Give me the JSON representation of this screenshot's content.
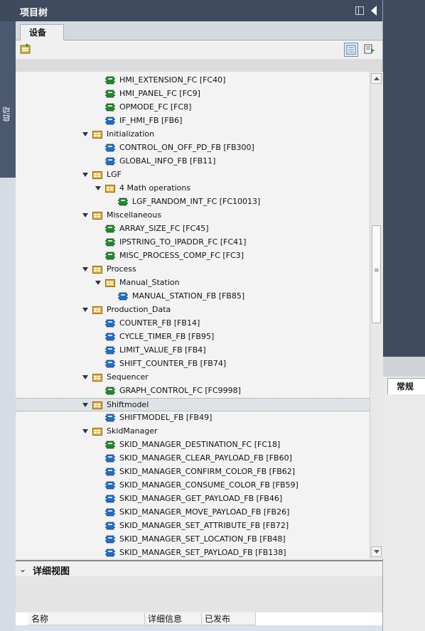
{
  "panel": {
    "title": "项目树",
    "side_tab": "启动",
    "tabs": [
      {
        "label": "设备"
      }
    ]
  },
  "tree": {
    "rows": [
      {
        "label": "HMI_EXTENSION_FC [FC40]",
        "icon": "fc-block-icon",
        "level": 3
      },
      {
        "label": "HMI_PANEL_FC [FC9]",
        "icon": "fc-block-icon",
        "level": 3
      },
      {
        "label": "OPMODE_FC [FC8]",
        "icon": "fc-block-icon",
        "level": 3
      },
      {
        "label": "IF_HMI_FB [FB6]",
        "icon": "fb-block-icon",
        "level": 3
      },
      {
        "label": "Initialization",
        "icon": "folder-icon",
        "level": 2,
        "expanded": true
      },
      {
        "label": "CONTROL_ON_OFF_PD_FB [FB300]",
        "icon": "fb-block-icon",
        "level": 3
      },
      {
        "label": "GLOBAL_INFO_FB [FB11]",
        "icon": "fb-block-icon",
        "level": 3
      },
      {
        "label": "LGF",
        "icon": "folder-icon",
        "level": 2,
        "expanded": true
      },
      {
        "label": "4 Math operations",
        "icon": "folder-icon",
        "level": 3,
        "expanded": true
      },
      {
        "label": "LGF_RANDOM_INT_FC [FC10013]",
        "icon": "fc-block-icon",
        "level": 4
      },
      {
        "label": "Miscellaneous",
        "icon": "folder-icon",
        "level": 2,
        "expanded": true
      },
      {
        "label": "ARRAY_SIZE_FC [FC45]",
        "icon": "fc-block-icon",
        "level": 3
      },
      {
        "label": "IPSTRING_TO_IPADDR_FC [FC41]",
        "icon": "fc-block-icon",
        "level": 3
      },
      {
        "label": "MISC_PROCESS_COMP_FC [FC3]",
        "icon": "fc-block-icon",
        "level": 3
      },
      {
        "label": "Process",
        "icon": "folder-icon",
        "level": 2,
        "expanded": true
      },
      {
        "label": "Manual_Station",
        "icon": "folder-icon",
        "level": 3,
        "expanded": true
      },
      {
        "label": "MANUAL_STATION_FB [FB85]",
        "icon": "fb-block-icon",
        "level": 4
      },
      {
        "label": "Production_Data",
        "icon": "folder-icon",
        "level": 2,
        "expanded": true
      },
      {
        "label": "COUNTER_FB [FB14]",
        "icon": "fb-block-icon",
        "level": 3
      },
      {
        "label": "CYCLE_TIMER_FB [FB95]",
        "icon": "fb-block-icon",
        "level": 3
      },
      {
        "label": "LIMIT_VALUE_FB [FB4]",
        "icon": "fb-block-icon",
        "level": 3
      },
      {
        "label": "SHIFT_COUNTER_FB [FB74]",
        "icon": "fb-block-icon",
        "level": 3
      },
      {
        "label": "Sequencer",
        "icon": "folder-icon",
        "level": 2,
        "expanded": true
      },
      {
        "label": "GRAPH_CONTROL_FC [FC9998]",
        "icon": "fc-block-icon",
        "level": 3
      },
      {
        "label": "Shiftmodel",
        "icon": "folder-icon",
        "level": 2,
        "expanded": true,
        "selected": true
      },
      {
        "label": "SHIFTMODEL_FB [FB49]",
        "icon": "fb-block-icon",
        "level": 3
      },
      {
        "label": "SkidManager",
        "icon": "folder-icon",
        "level": 2,
        "expanded": true
      },
      {
        "label": "SKID_MANAGER_DESTINATION_FC [FC18]",
        "icon": "fc-block-icon",
        "level": 3
      },
      {
        "label": "SKID_MANAGER_CLEAR_PAYLOAD_FB [FB60]",
        "icon": "fb-block-icon",
        "level": 3
      },
      {
        "label": "SKID_MANAGER_CONFIRM_COLOR_FB [FB62]",
        "icon": "fb-block-icon",
        "level": 3
      },
      {
        "label": "SKID_MANAGER_CONSUME_COLOR_FB [FB59]",
        "icon": "fb-block-icon",
        "level": 3
      },
      {
        "label": "SKID_MANAGER_GET_PAYLOAD_FB [FB46]",
        "icon": "fb-block-icon",
        "level": 3
      },
      {
        "label": "SKID_MANAGER_MOVE_PAYLOAD_FB [FB26]",
        "icon": "fb-block-icon",
        "level": 3
      },
      {
        "label": "SKID_MANAGER_SET_ATTRIBUTE_FB [FB72]",
        "icon": "fb-block-icon",
        "level": 3
      },
      {
        "label": "SKID_MANAGER_SET_LOCATION_FB [FB48]",
        "icon": "fb-block-icon",
        "level": 3
      },
      {
        "label": "SKID_MANAGER_SET_PAYLOAD_FB [FB138]",
        "icon": "fb-block-icon",
        "level": 3
      }
    ]
  },
  "details": {
    "title": "详细视图",
    "columns": [
      "名称",
      "详细信息",
      "已发布"
    ]
  },
  "inspector": {
    "tab": "常规"
  },
  "colors": {
    "title_bar": "#3e4b5e",
    "fc_green": "#1e8a2c",
    "fb_blue": "#1d6fc9",
    "folder_yellow": "#e8b23a"
  }
}
